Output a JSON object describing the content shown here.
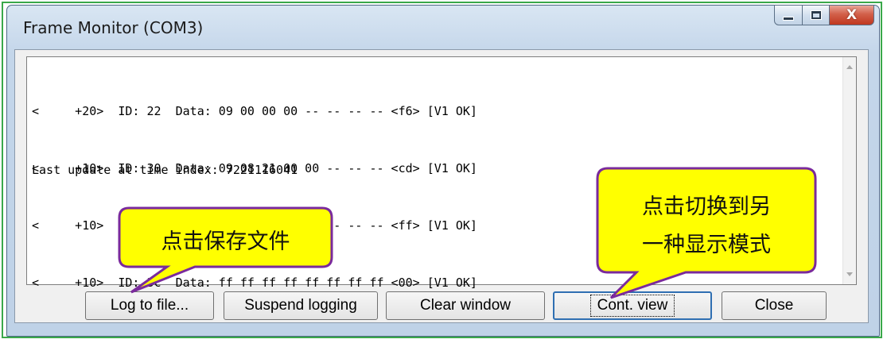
{
  "window": {
    "title": "Frame Monitor (COM3)",
    "close_glyph": "X"
  },
  "log": {
    "lines": [
      "<     +20>  ID: 22  Data: 09 00 00 00 -- -- -- -- <f6> [V1 OK]",
      "<     +10>  ID: 30  Data: 09 08 21 00 00 -- -- -- <cd> [V1 OK]",
      "<     +10>  ID: 31  Data: 00 00 00 00 00 -- -- -- <ff> [V1 OK]",
      "<     +10>  ID: 3c  Data: ff ff ff ff ff ff ff ff <00> [V1 OK]"
    ],
    "last_update": "Last update at time index: 7221116041"
  },
  "buttons": {
    "log_to_file": "Log to file...",
    "suspend_logging": "Suspend logging",
    "clear_window": "Clear window",
    "cont_view": "Cont. view",
    "close": "Close"
  },
  "annotations": {
    "save_file": "点击保存文件",
    "switch_line1": "点击切换到另",
    "switch_line2": "一种显示模式"
  },
  "colors": {
    "callout_fill": "#ffff00",
    "callout_border": "#7a2a9c",
    "outer_border": "#3aa84a",
    "close_button": "#c0371f"
  }
}
